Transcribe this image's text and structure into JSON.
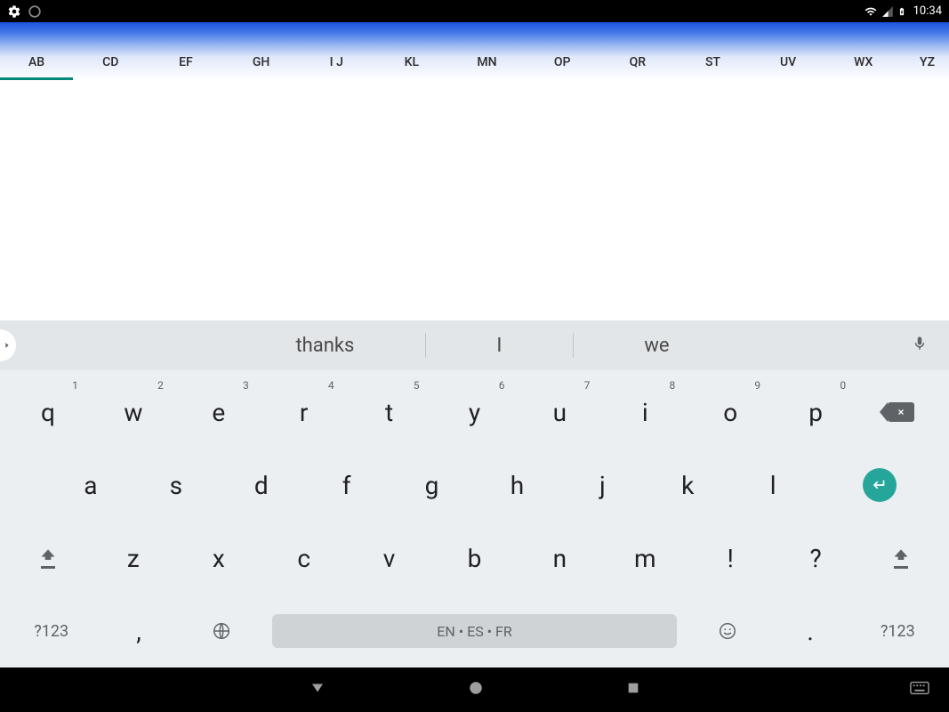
{
  "status": {
    "time": "10:34"
  },
  "tabs": {
    "items": [
      "AB",
      "CD",
      "EF",
      "GH",
      "I J",
      "KL",
      "MN",
      "OP",
      "QR",
      "ST",
      "UV",
      "WX",
      "YZ"
    ],
    "active_index": 0
  },
  "keyboard": {
    "suggestions": [
      "thanks",
      "I",
      "we"
    ],
    "row1": [
      {
        "k": "q",
        "h": "1"
      },
      {
        "k": "w",
        "h": "2"
      },
      {
        "k": "e",
        "h": "3"
      },
      {
        "k": "r",
        "h": "4"
      },
      {
        "k": "t",
        "h": "5"
      },
      {
        "k": "y",
        "h": "6"
      },
      {
        "k": "u",
        "h": "7"
      },
      {
        "k": "i",
        "h": "8"
      },
      {
        "k": "o",
        "h": "9"
      },
      {
        "k": "p",
        "h": "0"
      }
    ],
    "row2": [
      "a",
      "s",
      "d",
      "f",
      "g",
      "h",
      "j",
      "k",
      "l"
    ],
    "row3": [
      "z",
      "x",
      "c",
      "v",
      "b",
      "n",
      "m",
      "!",
      "?"
    ],
    "symbols_label": "?123",
    "space_label": "EN • ES • FR",
    "comma": ",",
    "period": "."
  }
}
